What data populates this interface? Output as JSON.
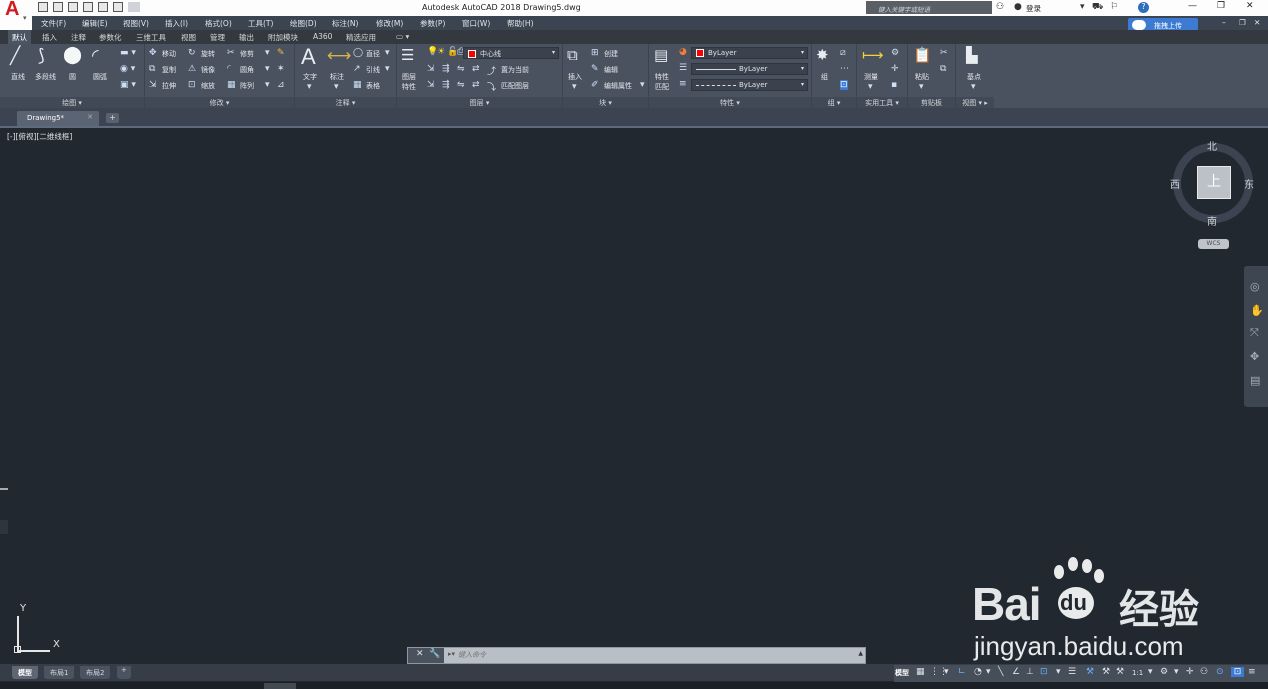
{
  "titlebar": {
    "app_title": "Autodesk AutoCAD 2018    Drawing5.dwg",
    "search_placeholder": "键入关键字或短语",
    "login": "登录",
    "help": "?"
  },
  "menubar": [
    "文件(F)",
    "编辑(E)",
    "视图(V)",
    "插入(I)",
    "格式(O)",
    "工具(T)",
    "绘图(D)",
    "标注(N)",
    "修改(M)",
    "参数(P)",
    "窗口(W)",
    "帮助(H)"
  ],
  "upload_button": "拖拽上传",
  "ribbon_tabs": [
    "默认",
    "插入",
    "注释",
    "参数化",
    "三维工具",
    "视图",
    "管理",
    "输出",
    "附加模块",
    "A360",
    "精选应用"
  ],
  "ribbon": {
    "draw": {
      "title": "绘图",
      "line": "直线",
      "polyline": "多段线",
      "circle": "圆",
      "arc": "圆弧"
    },
    "modify": {
      "title": "修改",
      "move": "移动",
      "rotate": "旋转",
      "trim": "修剪",
      "copy": "复制",
      "mirror": "镜像",
      "fillet": "圆角",
      "stretch": "拉伸",
      "scale": "缩放",
      "array": "阵列"
    },
    "annotation": {
      "title": "注释",
      "text": "文字",
      "dimension": "标注",
      "linear": "直径",
      "leader": "引线",
      "table": "表格"
    },
    "layers": {
      "title": "图层",
      "props_l1": "图层",
      "props_l2": "特性",
      "layer_name": "中心线",
      "set_current": "置为当前",
      "match_layer": "匹配图层"
    },
    "block": {
      "title": "块",
      "insert": "插入",
      "create": "创建",
      "edit": "编辑",
      "edit_attr": "编辑属性"
    },
    "properties": {
      "title": "特性",
      "match_l1": "特性",
      "match_l2": "匹配",
      "color": "ByLayer",
      "linetype": "ByLayer",
      "lineweight": "ByLayer"
    },
    "groups": {
      "title": "组",
      "group": "组"
    },
    "utilities": {
      "title": "实用工具",
      "measure": "测量"
    },
    "clipboard": {
      "title": "剪贴板",
      "paste": "粘贴"
    },
    "view": {
      "title": "视图",
      "base": "基点"
    }
  },
  "doc_tab": "Drawing5*",
  "viewport_label": "[-][俯视][二维线框]",
  "viewcube": {
    "top": "北",
    "bottom": "南",
    "left": "西",
    "right": "东",
    "face": "上",
    "wcs": "WCS"
  },
  "ucs": {
    "x": "X",
    "y": "Y"
  },
  "command_placeholder": "键入命令",
  "layout_tabs": [
    "模型",
    "布局1",
    "布局2"
  ],
  "status": {
    "model": "模型",
    "scale": "1:1"
  },
  "watermark": {
    "brand": "Bai",
    "brand2": "du",
    "cn": "经验",
    "url": "jingyan.baidu.com"
  },
  "colors": {
    "accent": "#d01b21",
    "canvas": "#212830",
    "ribbon": "#4a5260",
    "upload": "#3d7bd2"
  }
}
